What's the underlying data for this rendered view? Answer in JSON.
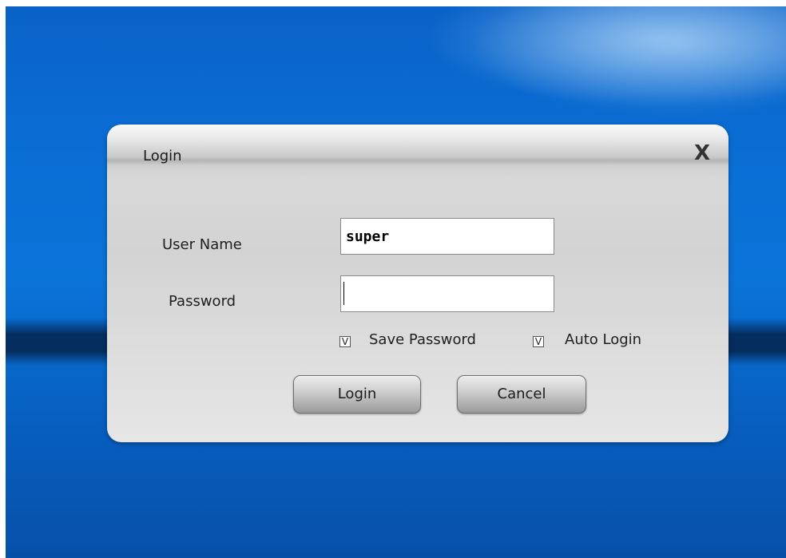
{
  "dialog": {
    "title": "Login",
    "close_glyph": "X"
  },
  "form": {
    "username_label": "User Name",
    "username_value": "super",
    "password_label": "Password",
    "password_value": ""
  },
  "options": {
    "save_password": {
      "label": "Save Password",
      "checked": true,
      "mark": "V"
    },
    "auto_login": {
      "label": "Auto Login",
      "checked": true,
      "mark": "V"
    }
  },
  "buttons": {
    "login": "Login",
    "cancel": "Cancel"
  },
  "colors": {
    "desktop_blue": "#0a6fd6",
    "dialog_gray": "#d8d8d8"
  }
}
